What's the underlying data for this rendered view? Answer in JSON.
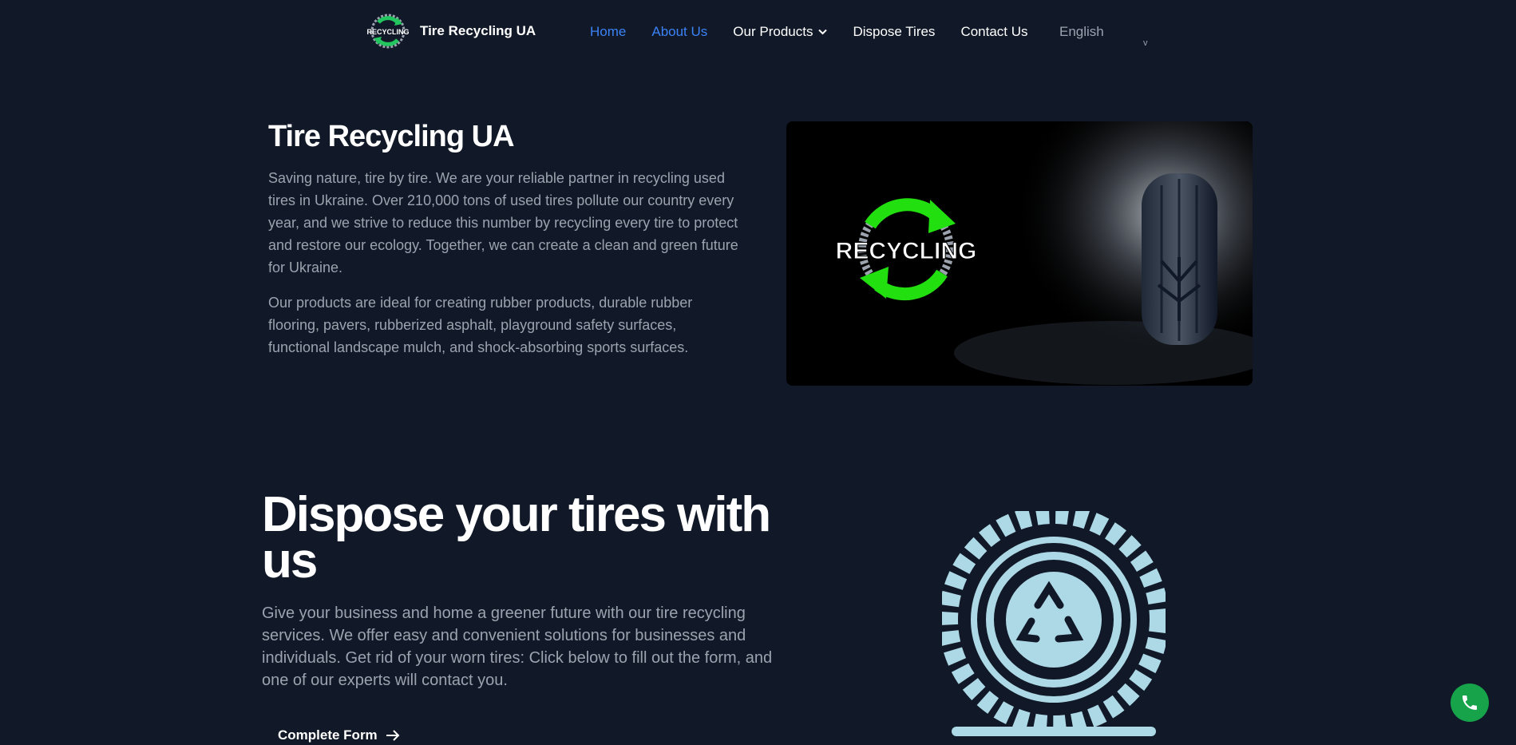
{
  "nav": {
    "brand_name": "Tire Recycling UA",
    "logo_text": "RECYCLING",
    "links": [
      {
        "label": "Home",
        "active": true
      },
      {
        "label": "About Us"
      },
      {
        "label": "Our Products"
      },
      {
        "label": "Dispose Tires"
      },
      {
        "label": "Contact Us"
      }
    ],
    "language": "English",
    "language_caret": "v"
  },
  "hero": {
    "title": "Tire Recycling UA",
    "paragraph1": "Saving nature, tire by tire. We are your reliable partner in recycling used tires in Ukraine. Over 210,000 tons of used tires pollute our country every year, and we strive to reduce this number by recycling every tire to protect and restore our ecology. Together, we can create a clean and green future for Ukraine.",
    "paragraph2": "Our products are ideal for creating rubber products, durable rubber flooring, pavers, rubberized asphalt, playground safety surfaces, functional landscape mulch, and shock-absorbing sports surfaces.",
    "image_logo_text": "RECYCLING"
  },
  "dispose": {
    "title": "Dispose your tires with us",
    "paragraph": "Give your business and home a greener future with our tire recycling services. We offer easy and convenient solutions for businesses and individuals. Get rid of your worn tires: Click below to fill out the form, and one of our experts will contact you.",
    "cta_label": "Complete Form"
  },
  "colors": {
    "background": "#111827",
    "link_active": "#3b82f6",
    "recycle_green": "#22c55e",
    "tire_icon": "#add8e6",
    "phone_button": "#16a34a"
  },
  "icons": [
    "recycling-logo-icon",
    "chevron-down-icon",
    "arrow-right-icon",
    "tire-recycle-icon",
    "phone-icon"
  ]
}
